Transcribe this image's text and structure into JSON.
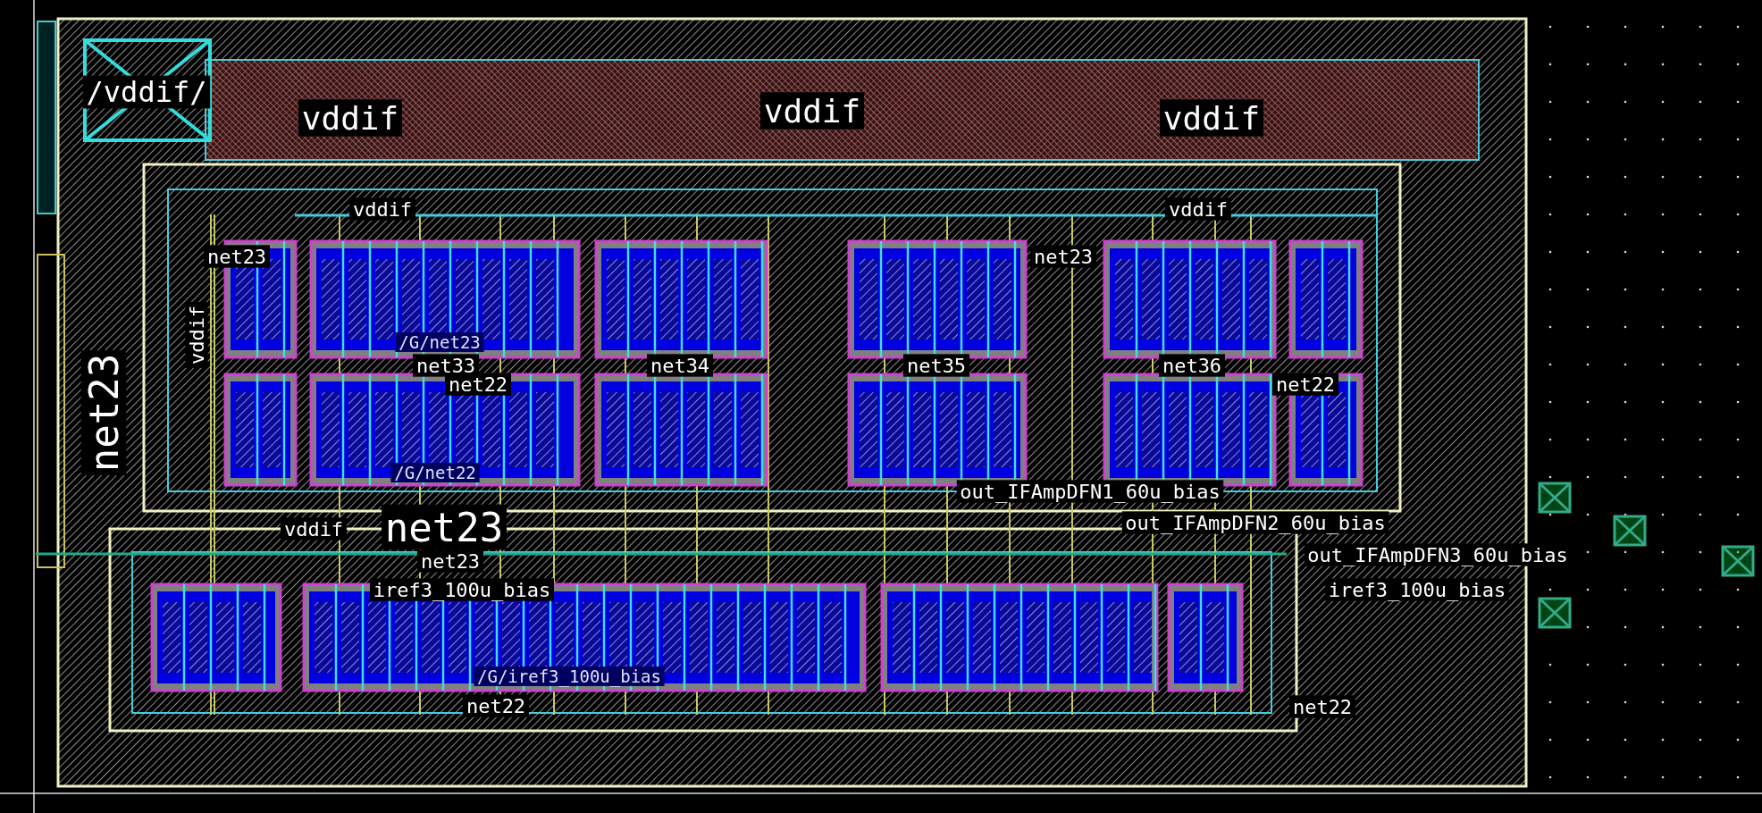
{
  "labels": [
    {
      "text": "/vddif/",
      "kind": "pin"
    },
    {
      "text": "vddif",
      "kind": "power"
    },
    {
      "text": "vddif",
      "kind": "power"
    },
    {
      "text": "vddif",
      "kind": "power"
    },
    {
      "text": "vddif",
      "kind": "net"
    },
    {
      "text": "vddif",
      "kind": "net"
    },
    {
      "text": "net23",
      "kind": "net"
    },
    {
      "text": "net23",
      "kind": "net"
    },
    {
      "text": "/G/net23",
      "kind": "device"
    },
    {
      "text": "vddif",
      "kind": "net"
    },
    {
      "text": "net33",
      "kind": "net"
    },
    {
      "text": "net34",
      "kind": "net"
    },
    {
      "text": "net35",
      "kind": "net"
    },
    {
      "text": "net36",
      "kind": "net"
    },
    {
      "text": "net22",
      "kind": "net"
    },
    {
      "text": "net22",
      "kind": "net"
    },
    {
      "text": "net23",
      "kind": "net-large"
    },
    {
      "text": "/G/net22",
      "kind": "device"
    },
    {
      "text": "out_IFAmpDFN1_60u_bias",
      "kind": "net"
    },
    {
      "text": "vddif",
      "kind": "net"
    },
    {
      "text": "net23",
      "kind": "net-large"
    },
    {
      "text": "out_IFAmpDFN2_60u_bias",
      "kind": "net"
    },
    {
      "text": "net23",
      "kind": "net"
    },
    {
      "text": "out_IFAmpDFN3_60u_bias",
      "kind": "net"
    },
    {
      "text": "iref3_100u_bias",
      "kind": "net"
    },
    {
      "text": "iref3_100u_bias",
      "kind": "net"
    },
    {
      "text": "/G/iref3_100u_bias",
      "kind": "device"
    },
    {
      "text": "net22",
      "kind": "net"
    },
    {
      "text": "net22",
      "kind": "net"
    }
  ]
}
